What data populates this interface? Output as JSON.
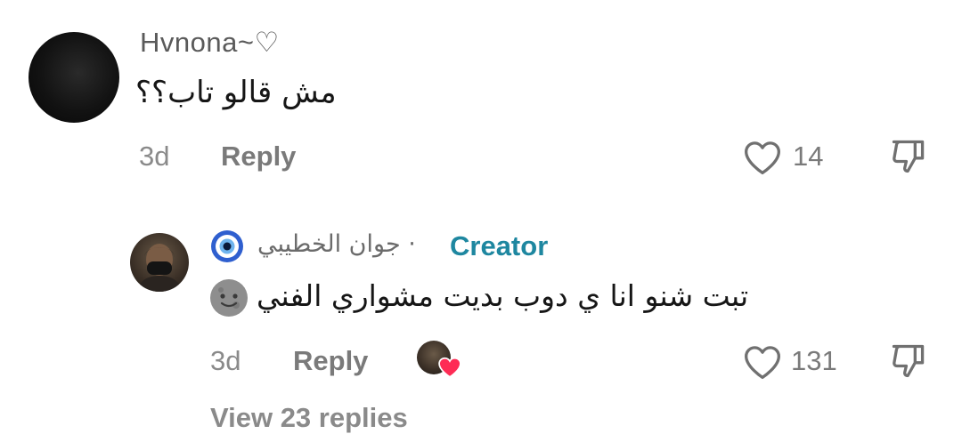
{
  "comments": [
    {
      "username": "Hvnona~♡",
      "text": "مش قالو تاب؟؟",
      "age": "3d",
      "reply_label": "Reply",
      "like_count": "14"
    }
  ],
  "reply": {
    "author_name": "جوان الخطيبي ·",
    "creator_label": "Creator",
    "text": "تبت شنو انا ي دوب بديت مشواري الفني",
    "age": "3d",
    "reply_label": "Reply",
    "like_count": "131"
  },
  "view_more_label": "View 23 replies",
  "colors": {
    "creator_accent": "#1e87a0",
    "heart_badge": "#fe2c55",
    "muted_text": "#8a8a8a"
  },
  "icons": [
    "heart-outline-icon",
    "thumbs-down-outline-icon",
    "evil-eye-icon",
    "moon-face-emoji-icon",
    "heart-badge-icon"
  ]
}
